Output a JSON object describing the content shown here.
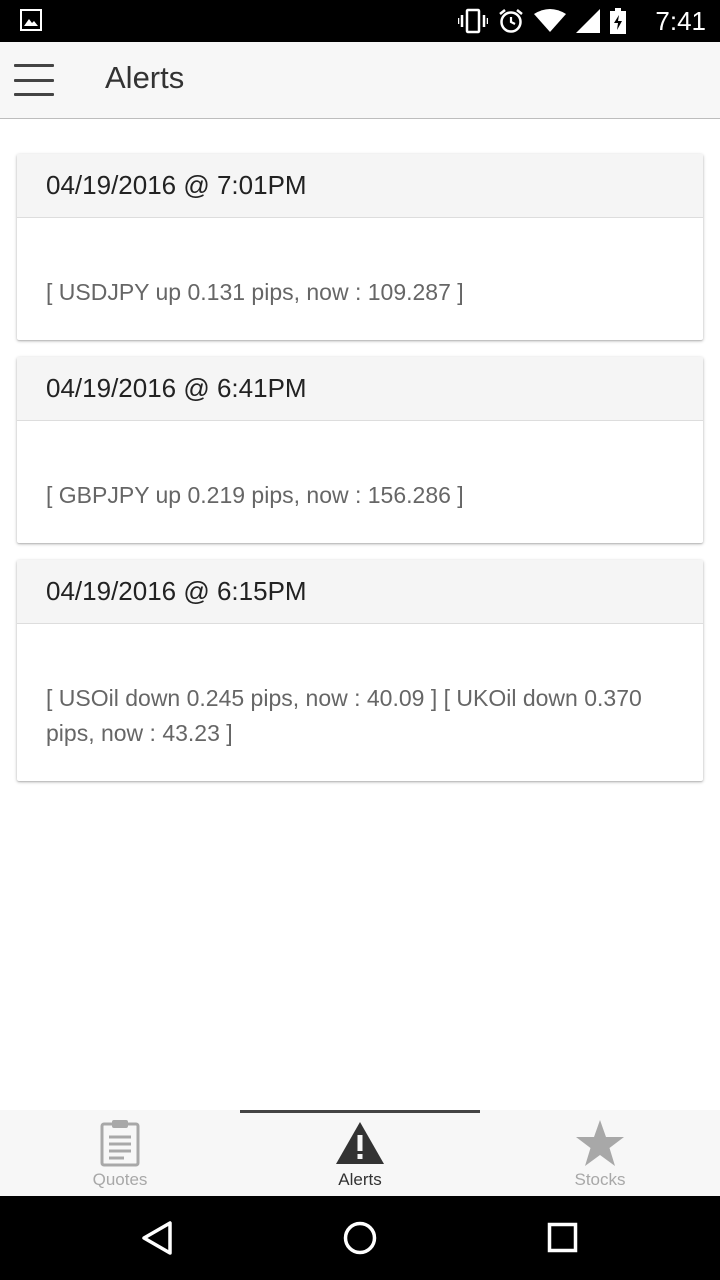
{
  "status_bar": {
    "time": "7:41",
    "icons": [
      "image-notification-icon",
      "vibrate-icon",
      "alarm-icon",
      "wifi-icon",
      "cell-signal-icon",
      "battery-icon"
    ]
  },
  "app_bar": {
    "title": "Alerts",
    "menu_icon": "hamburger-menu-icon"
  },
  "alerts": [
    {
      "timestamp": "04/19/2016 @ 7:01PM",
      "message": "[ USDJPY up 0.131 pips, now : 109.287 ]"
    },
    {
      "timestamp": "04/19/2016 @ 6:41PM",
      "message": "[ GBPJPY up 0.219 pips, now : 156.286 ]"
    },
    {
      "timestamp": "04/19/2016 @ 6:15PM",
      "message": "[ USOil down 0.245 pips, now : 40.09 ] [ UKOil down 0.370 pips, now : 43.23 ]"
    }
  ],
  "tabs": [
    {
      "label": "Quotes",
      "icon": "clipboard-icon",
      "active": false
    },
    {
      "label": "Alerts",
      "icon": "warning-icon",
      "active": true
    },
    {
      "label": "Stocks",
      "icon": "star-icon",
      "active": false
    }
  ],
  "nav_bar": {
    "icons": [
      "back-icon",
      "home-icon",
      "recents-icon"
    ]
  },
  "colors": {
    "app_bar_bg": "#f7f7f7",
    "card_header_bg": "#f5f5f5",
    "active_tab_indicator": "#444444",
    "inactive_tab": "#a8a8a8"
  }
}
